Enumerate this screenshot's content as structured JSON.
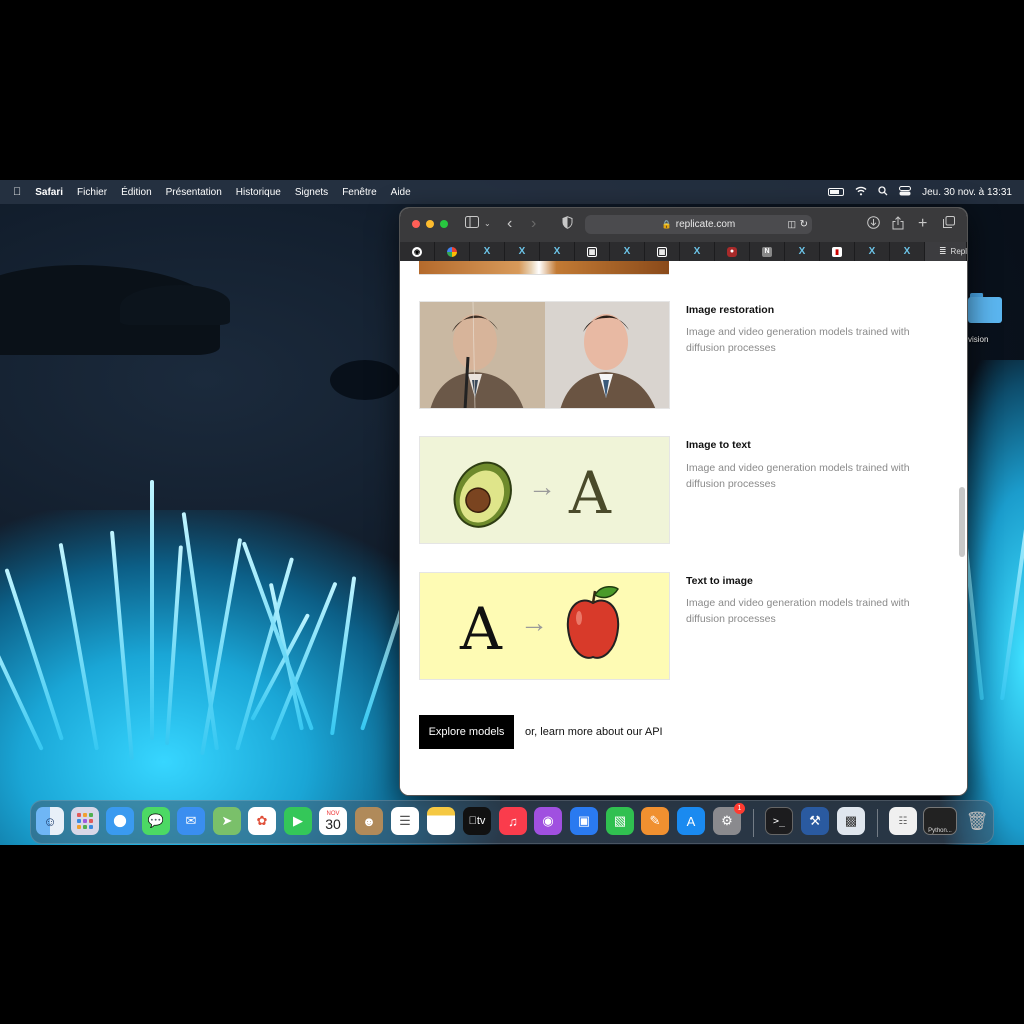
{
  "menubar": {
    "app": "Safari",
    "items": [
      "Fichier",
      "Édition",
      "Présentation",
      "Historique",
      "Signets",
      "Fenêtre",
      "Aide"
    ],
    "clock": "Jeu. 30 nov. à 13:31"
  },
  "desktop": {
    "folder_label": "vision"
  },
  "browser": {
    "url": "replicate.com",
    "active_tab": "Replicat...",
    "tabs": [
      "github-icon",
      "google-icon",
      "x-icon",
      "x-icon",
      "x-icon",
      "box-icon",
      "x-icon",
      "box-icon",
      "x-icon",
      "record-icon",
      "notion-icon",
      "x-icon",
      "red-square-icon",
      "x-icon",
      "x-icon"
    ]
  },
  "content": {
    "items": [
      {
        "title": "Image restoration",
        "description": "Image and video generation models trained with diffusion processes"
      },
      {
        "title": "Image to text",
        "description": "Image and video generation models trained with diffusion processes"
      },
      {
        "title": "Text to image",
        "description": "Image and video generation models trained with diffusion processes"
      }
    ],
    "explore_button": "Explore models",
    "api_link": "or, learn more about our API",
    "letter_glyph": "A",
    "arrow_glyph": "→"
  },
  "dock": {
    "calendar_month": "NOV",
    "calendar_day": "30",
    "appletv_label": "tv",
    "settings_badge": "1",
    "python_label": "Python...",
    "colors": {
      "accent_black": "#000000",
      "restoration_bg": "#ffffff",
      "image_to_text_bg": "#f0f4d8",
      "text_to_image_bg": "#fefbb4"
    }
  }
}
